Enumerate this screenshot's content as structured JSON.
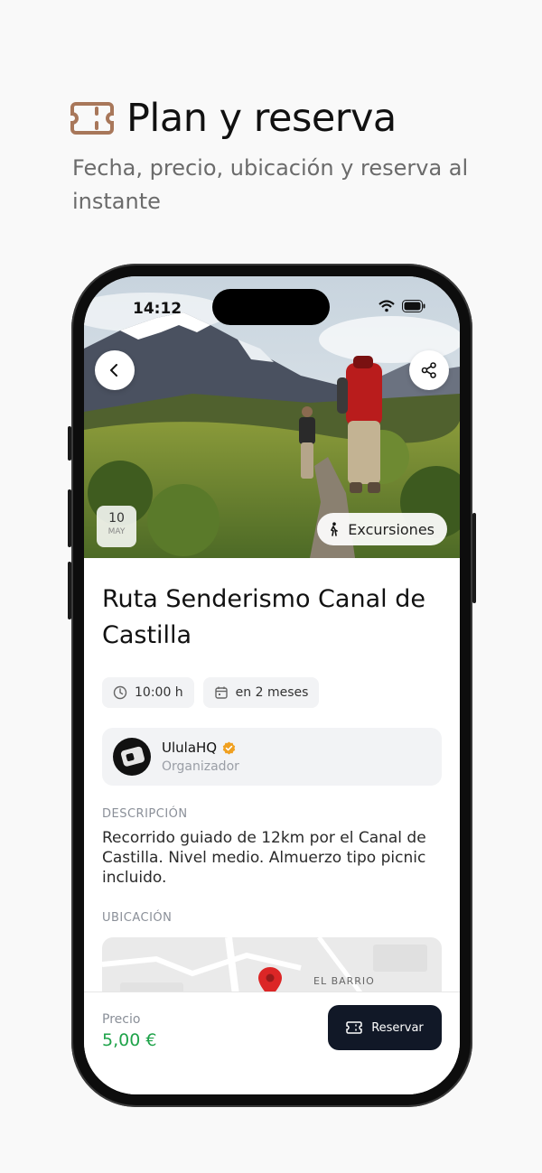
{
  "header": {
    "title": "Plan y reserva",
    "subtitle": "Fecha, precio, ubicación y reserva al instante",
    "icon": "ticket-icon",
    "accent": "#a8775a"
  },
  "status_bar": {
    "time": "14:12"
  },
  "event": {
    "date_day": "10",
    "date_month": "MAY",
    "category": "Excursiones",
    "title": "Ruta Senderismo Canal de Castilla",
    "time": "10:00 h",
    "relative_date": "en 2 meses",
    "organizer": {
      "name": "UlulaHQ",
      "role": "Organizador",
      "verified": true
    },
    "description_label": "DESCRIPCIÓN",
    "description": "Recorrido guiado de 12km por el Canal de Castilla. Nivel medio. Almuerzo tipo picnic incluido.",
    "location_label": "UBICACIÓN",
    "map_label": "EL BARRIO"
  },
  "booking": {
    "price_label": "Precio",
    "price": "5,00 €",
    "reserve_label": "Reservar",
    "price_color": "#1fa34a",
    "button_color": "#111827"
  }
}
